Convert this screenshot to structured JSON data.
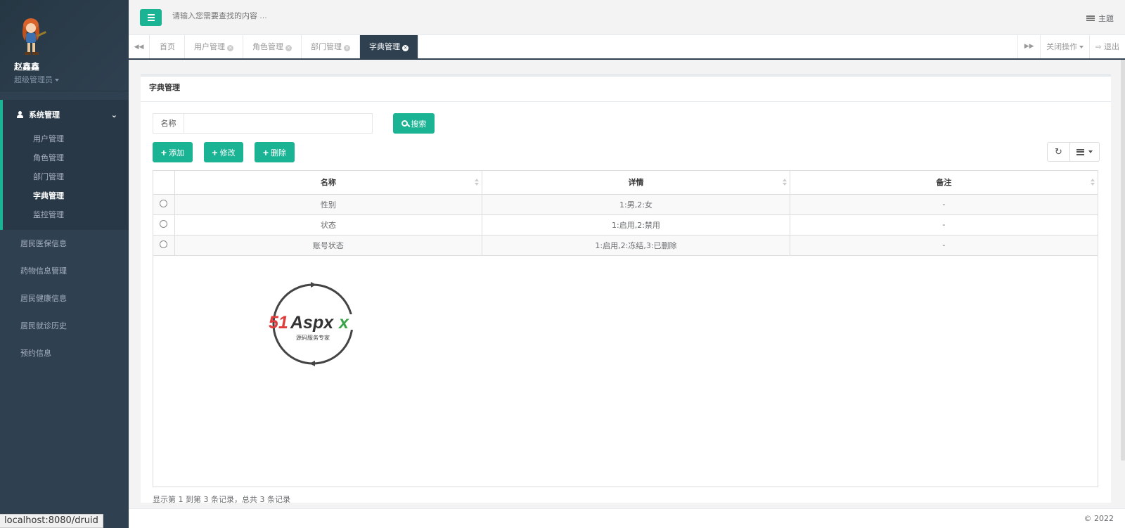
{
  "sidebar": {
    "user_name": "赵鑫鑫",
    "user_role": "超级管理员",
    "group_title": "系统管理",
    "sub_items": [
      {
        "label": "用户管理",
        "active": false
      },
      {
        "label": "角色管理",
        "active": false
      },
      {
        "label": "部门管理",
        "active": false
      },
      {
        "label": "字典管理",
        "active": true
      },
      {
        "label": "监控管理",
        "active": false
      }
    ],
    "items": [
      {
        "label": "居民医保信息"
      },
      {
        "label": "药物信息管理"
      },
      {
        "label": "居民健康信息"
      },
      {
        "label": "居民就诊历史"
      },
      {
        "label": "预约信息"
      }
    ]
  },
  "topbar": {
    "search_placeholder": "请输入您需要查找的内容 …",
    "theme_label": "主题"
  },
  "tabs": [
    {
      "label": "首页",
      "closable": false,
      "active": false
    },
    {
      "label": "用户管理",
      "closable": true,
      "active": false
    },
    {
      "label": "角色管理",
      "closable": true,
      "active": false
    },
    {
      "label": "部门管理",
      "closable": true,
      "active": false
    },
    {
      "label": "字典管理",
      "closable": true,
      "active": true
    }
  ],
  "tab_actions": {
    "close_ops": "关闭操作",
    "logout": "退出"
  },
  "panel": {
    "title": "字典管理",
    "search_label": "名称",
    "search_value": "",
    "search_button": "搜索",
    "add_button": "添加",
    "edit_button": "修改",
    "delete_button": "删除"
  },
  "table": {
    "columns": [
      "名称",
      "详情",
      "备注"
    ],
    "rows": [
      {
        "name": "性别",
        "detail": "1:男,2:女",
        "remark": "-"
      },
      {
        "name": "状态",
        "detail": "1:启用,2:禁用",
        "remark": "-"
      },
      {
        "name": "账号状态",
        "detail": "1:启用,2:冻结,3:已删除",
        "remark": "-"
      }
    ],
    "pager_text": "显示第 1 到第 3 条记录，总共 3 条记录"
  },
  "watermark": {
    "brand": "51Aspx",
    "tagline": "源码服务专家"
  },
  "footer": {
    "copyright": "© 2022"
  },
  "status_url": "localhost:8080/druid",
  "colors": {
    "accent": "#1ab394",
    "sidebar_bg": "#2f4050"
  }
}
